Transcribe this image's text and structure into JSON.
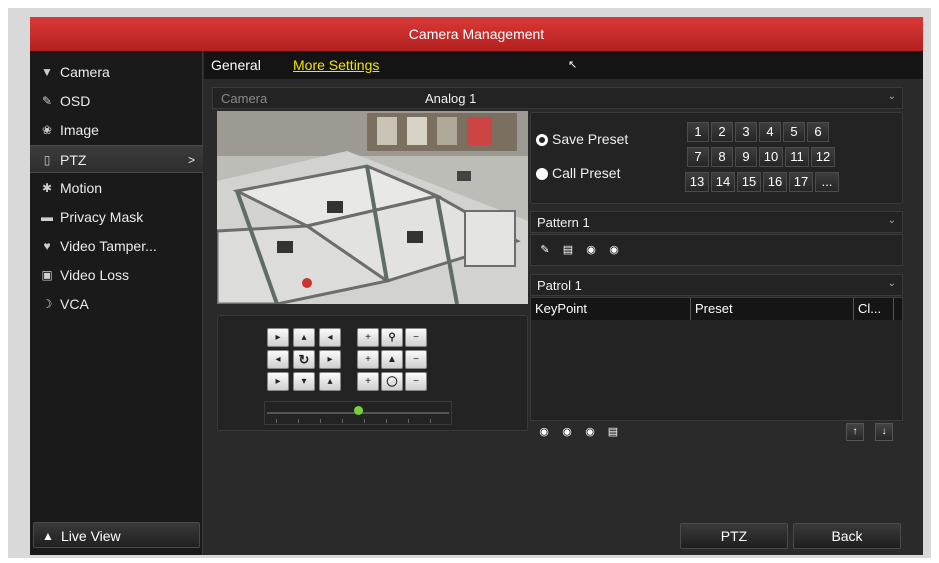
{
  "window": {
    "title": "Camera Management"
  },
  "sidebar": {
    "items": [
      {
        "label": "Camera",
        "icon": "camera-icon"
      },
      {
        "label": "OSD",
        "icon": "osd-icon"
      },
      {
        "label": "Image",
        "icon": "image-icon"
      },
      {
        "label": "PTZ",
        "icon": "ptz-icon",
        "arrow": ">"
      },
      {
        "label": "Motion",
        "icon": "motion-icon"
      },
      {
        "label": "Privacy Mask",
        "icon": "privacy-mask-icon"
      },
      {
        "label": "Video Tamper...",
        "icon": "video-tamper-icon"
      },
      {
        "label": "Video Loss",
        "icon": "video-loss-icon"
      },
      {
        "label": "VCA",
        "icon": "vca-icon"
      }
    ],
    "live_view_label": "Live View"
  },
  "tabs": {
    "general": "General",
    "more_settings": "More Settings"
  },
  "camera_select": {
    "label": "Camera",
    "value": "Analog 1"
  },
  "presets": {
    "save_label": "Save Preset",
    "call_label": "Call Preset",
    "numbers": [
      "1",
      "2",
      "3",
      "4",
      "5",
      "6",
      "7",
      "8",
      "9",
      "10",
      "11",
      "12",
      "13",
      "14",
      "15",
      "16",
      "17",
      "..."
    ]
  },
  "pattern": {
    "value": "Pattern 1"
  },
  "patrol": {
    "value": "Patrol 1"
  },
  "patrol_table": {
    "columns": [
      "KeyPoint",
      "Preset",
      "Cl..."
    ]
  },
  "footer": {
    "ptz_label": "PTZ",
    "back_label": "Back"
  },
  "colors": {
    "title_red": "#c8282a",
    "active_tab": "#f5e400",
    "speed_knob": "#7bcf3a"
  }
}
